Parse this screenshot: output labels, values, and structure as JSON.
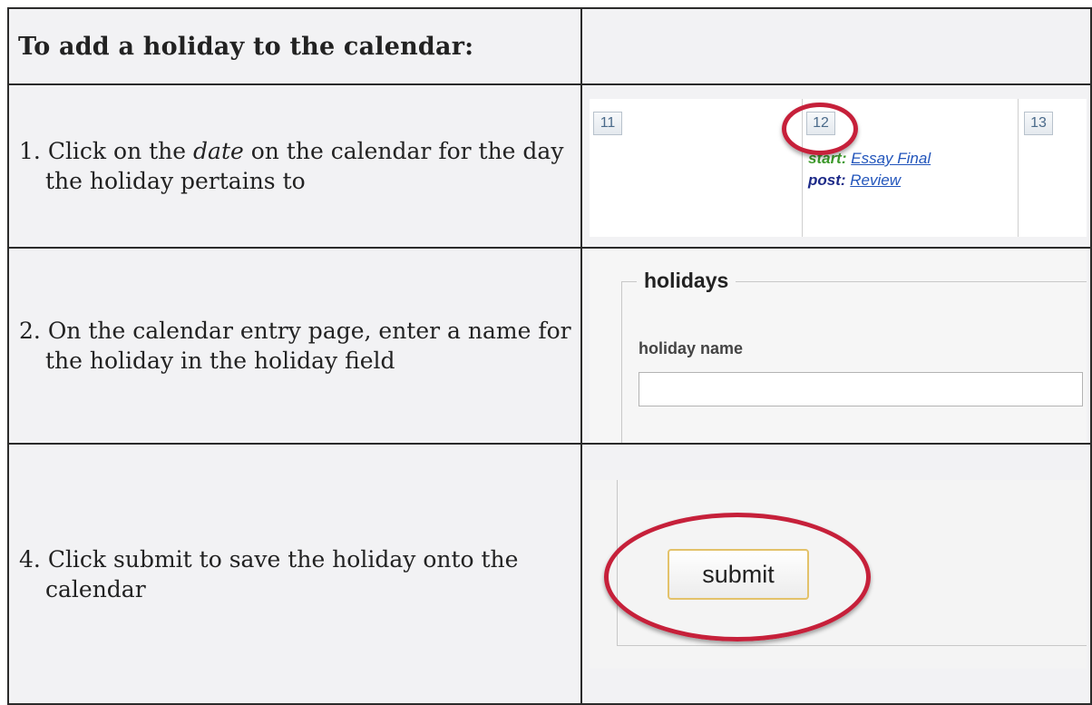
{
  "header": {
    "title": "To add a holiday to the calendar:"
  },
  "steps": [
    {
      "number": "1.",
      "text_before": "Click on the ",
      "emphasis": "date",
      "text_after": " on the calendar for the day the holiday pertains to"
    },
    {
      "number": "2.",
      "text": "On the calendar entry page, enter a name for the holiday in the holiday field"
    },
    {
      "number": "4.",
      "text": "Click submit to save the holiday onto the calendar"
    }
  ],
  "calendar_shot": {
    "days": [
      "11",
      "12",
      "13"
    ],
    "entries": [
      {
        "label": "start:",
        "link": "Essay Final"
      },
      {
        "label": "post:",
        "link": "Review"
      }
    ],
    "highlight_color": "#c6203a"
  },
  "holiday_shot": {
    "legend": "holidays",
    "field_label": "holiday name",
    "field_value": ""
  },
  "submit_shot": {
    "button_label": "submit",
    "highlight_color": "#c6203a"
  }
}
